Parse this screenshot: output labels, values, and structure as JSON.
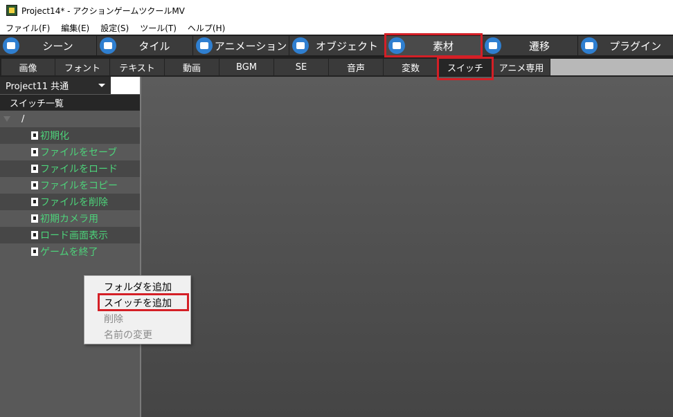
{
  "window": {
    "title": "Project14* - アクションゲームツクールMV"
  },
  "menubar": [
    "ファイル(F)",
    "編集(E)",
    "設定(S)",
    "ツール(T)",
    "ヘルプ(H)"
  ],
  "main_tabs": [
    {
      "label": "シーン",
      "icon": "scene-icon"
    },
    {
      "label": "タイル",
      "icon": "tile-icon"
    },
    {
      "label": "アニメーション",
      "icon": "animation-icon"
    },
    {
      "label": "オブジェクト",
      "icon": "object-icon"
    },
    {
      "label": "素材",
      "icon": "material-icon",
      "active": true
    },
    {
      "label": "遷移",
      "icon": "transition-icon"
    },
    {
      "label": "プラグイン",
      "icon": "plugin-icon"
    }
  ],
  "sub_tabs": [
    {
      "label": "画像"
    },
    {
      "label": "フォント"
    },
    {
      "label": "テキスト"
    },
    {
      "label": "動画"
    },
    {
      "label": "BGM"
    },
    {
      "label": "SE"
    },
    {
      "label": "音声"
    },
    {
      "label": "変数"
    },
    {
      "label": "スイッチ",
      "active": true
    },
    {
      "label": "アニメ専用"
    }
  ],
  "sidebar": {
    "project_select": "Project11 共通",
    "list_header": "スイッチ一覧",
    "root_folder": "/",
    "switches": [
      "初期化",
      "ファイルをセーブ",
      "ファイルをロード",
      "ファイルをコピー",
      "ファイルを削除",
      "初期カメラ用",
      "ロード画面表示",
      "ゲームを終了"
    ]
  },
  "context_menu": {
    "items": [
      {
        "label": "フォルダを追加",
        "enabled": true
      },
      {
        "label": "スイッチを追加",
        "enabled": true
      },
      {
        "label": "削除",
        "enabled": false
      },
      {
        "label": "名前の変更",
        "enabled": false
      }
    ]
  },
  "colors": {
    "highlight": "#d41f26",
    "switch_text": "#4dd37a"
  }
}
